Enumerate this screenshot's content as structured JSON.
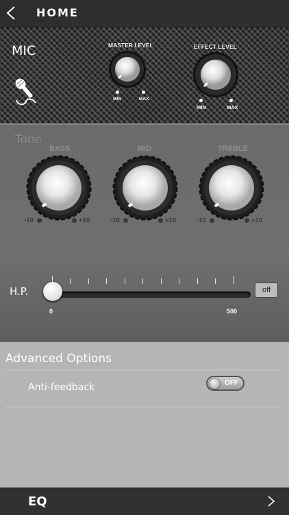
{
  "header": {
    "title": "HOME",
    "back_icon": "chevron-left-icon"
  },
  "mic": {
    "title": "MIC",
    "icon": "microphone-icon",
    "master_level": {
      "label": "MASTER LEVEL",
      "min": "MIN",
      "max": "MAX",
      "level": 0.15
    },
    "effect_level": {
      "label": "EFFECT LEVEL",
      "min": "MIN",
      "max": "MAX",
      "level": 0.15
    }
  },
  "tone": {
    "title": "Tone",
    "knobs": [
      {
        "label": "BASS",
        "min": "-10",
        "max": "+10",
        "level": 0.2
      },
      {
        "label": "MID",
        "min": "-10",
        "max": "+10",
        "level": 0.2
      },
      {
        "label": "TREBLE",
        "min": "-10",
        "max": "+10",
        "level": 0.2
      }
    ],
    "hp": {
      "label": "H.P.",
      "min": "0",
      "max": "500",
      "value": 0,
      "toggle": "off"
    }
  },
  "advanced": {
    "title": "Advanced Options",
    "anti_feedback": {
      "label": "Anti-feedback",
      "state": "OFF"
    }
  },
  "footer": {
    "label": "EQ",
    "chevron_icon": "chevron-right-icon"
  }
}
